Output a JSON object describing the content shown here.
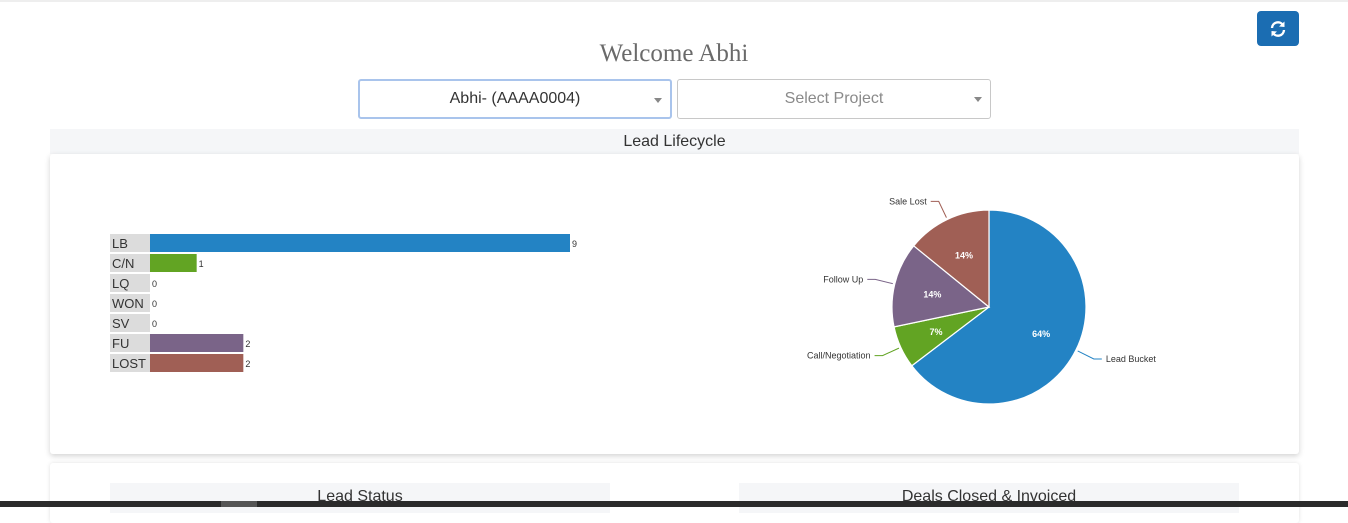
{
  "header": {
    "welcome": "Welcome Abhi",
    "refresh_icon": "refresh-icon"
  },
  "filters": {
    "user_selected": "Abhi- (AAAA0004)",
    "project_placeholder": "Select Project"
  },
  "lead_lifecycle": {
    "title": "Lead Lifecycle"
  },
  "sections": {
    "lead_status": "Lead Status",
    "deals_closed": "Deals Closed & Invoiced"
  },
  "chart_data": [
    {
      "type": "bar",
      "orientation": "horizontal",
      "categories": [
        "LB",
        "C/N",
        "LQ",
        "WON",
        "SV",
        "FU",
        "LOST"
      ],
      "values": [
        9,
        1,
        0,
        0,
        0,
        2,
        2
      ],
      "colors": [
        "#2383c4",
        "#62a423",
        "#2383c4",
        "#2383c4",
        "#2383c4",
        "#7a6488",
        "#a05f55"
      ],
      "grid": false
    },
    {
      "type": "pie",
      "labels": [
        "Lead Bucket",
        "Call/Negotiation",
        "Follow Up",
        "Sale Lost"
      ],
      "values": [
        64,
        7,
        14,
        14
      ],
      "display_values": [
        "64%",
        "7%",
        "14%",
        "14%"
      ],
      "colors": [
        "#2383c4",
        "#62a423",
        "#7a6488",
        "#a05f55"
      ]
    }
  ]
}
